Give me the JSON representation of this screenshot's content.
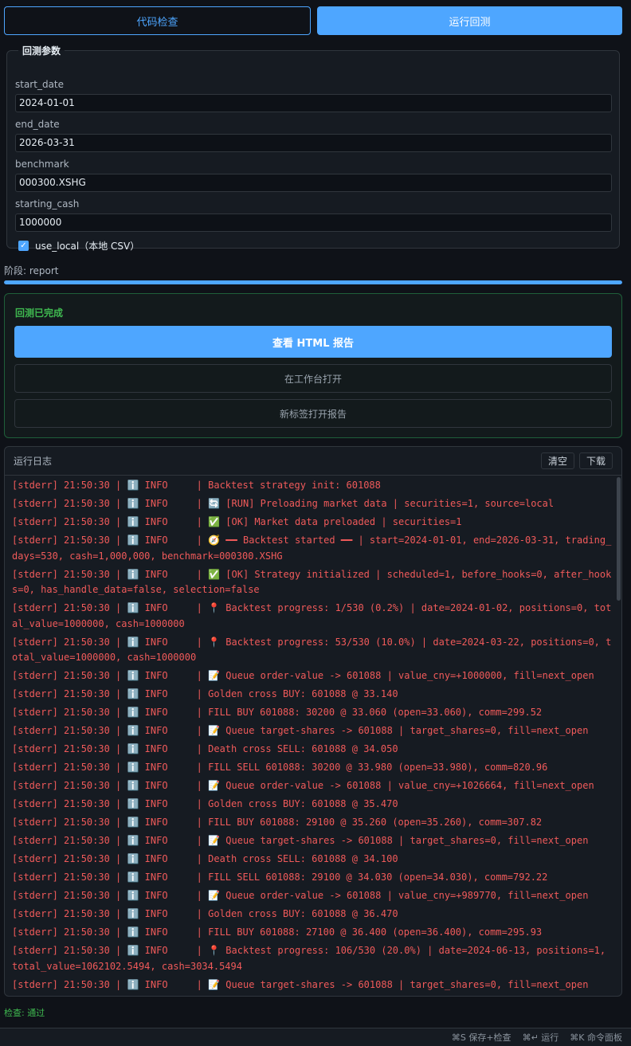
{
  "toolbar": {
    "check_label": "代码检查",
    "run_label": "运行回测"
  },
  "params": {
    "legend": "回测参数",
    "fields": [
      {
        "label": "start_date",
        "value": "2024-01-01"
      },
      {
        "label": "end_date",
        "value": "2026-03-31"
      },
      {
        "label": "benchmark",
        "value": "000300.XSHG"
      },
      {
        "label": "starting_cash",
        "value": "1000000"
      }
    ],
    "use_local_label": "use_local（本地 CSV）",
    "use_local_checked": true
  },
  "stage": {
    "text": "阶段: report",
    "progress": 1.0
  },
  "result": {
    "title": "回测已完成",
    "view_report_label": "查看 HTML 报告",
    "open_workbench_label": "在工作台打开",
    "open_new_tab_label": "新标签打开报告"
  },
  "log": {
    "title": "运行日志",
    "clear_label": "清空",
    "download_label": "下载",
    "lines": [
      "[stderr] 21:50:30 | ℹ️ INFO     | Backtest strategy init: 601088",
      "[stderr] 21:50:30 | ℹ️ INFO     | 🔄 [RUN] Preloading market data | securities=1, source=local",
      "[stderr] 21:50:30 | ℹ️ INFO     | ✅ [OK] Market data preloaded | securities=1",
      "[stderr] 21:50:30 | ℹ️ INFO     | 🧭 ━━ Backtest started ━━ | start=2024-01-01, end=2026-03-31, trading_days=530, cash=1,000,000, benchmark=000300.XSHG",
      "[stderr] 21:50:30 | ℹ️ INFO     | ✅ [OK] Strategy initialized | scheduled=1, before_hooks=0, after_hooks=0, has_handle_data=false, selection=false",
      "[stderr] 21:50:30 | ℹ️ INFO     | 📍 Backtest progress: 1/530 (0.2%) | date=2024-01-02, positions=0, total_value=1000000, cash=1000000",
      "[stderr] 21:50:30 | ℹ️ INFO     | 📍 Backtest progress: 53/530 (10.0%) | date=2024-03-22, positions=0, total_value=1000000, cash=1000000",
      "[stderr] 21:50:30 | ℹ️ INFO     | 📝 Queue order-value -> 601088 | value_cny=+1000000, fill=next_open",
      "[stderr] 21:50:30 | ℹ️ INFO     | Golden cross BUY: 601088 @ 33.140",
      "[stderr] 21:50:30 | ℹ️ INFO     | FILL BUY 601088: 30200 @ 33.060 (open=33.060), comm=299.52",
      "[stderr] 21:50:30 | ℹ️ INFO     | 📝 Queue target-shares -> 601088 | target_shares=0, fill=next_open",
      "[stderr] 21:50:30 | ℹ️ INFO     | Death cross SELL: 601088 @ 34.050",
      "[stderr] 21:50:30 | ℹ️ INFO     | FILL SELL 601088: 30200 @ 33.980 (open=33.980), comm=820.96",
      "[stderr] 21:50:30 | ℹ️ INFO     | 📝 Queue order-value -> 601088 | value_cny=+1026664, fill=next_open",
      "[stderr] 21:50:30 | ℹ️ INFO     | Golden cross BUY: 601088 @ 35.470",
      "[stderr] 21:50:30 | ℹ️ INFO     | FILL BUY 601088: 29100 @ 35.260 (open=35.260), comm=307.82",
      "[stderr] 21:50:30 | ℹ️ INFO     | 📝 Queue target-shares -> 601088 | target_shares=0, fill=next_open",
      "[stderr] 21:50:30 | ℹ️ INFO     | Death cross SELL: 601088 @ 34.100",
      "[stderr] 21:50:30 | ℹ️ INFO     | FILL SELL 601088: 29100 @ 34.030 (open=34.030), comm=792.22",
      "[stderr] 21:50:30 | ℹ️ INFO     | 📝 Queue order-value -> 601088 | value_cny=+989770, fill=next_open",
      "[stderr] 21:50:30 | ℹ️ INFO     | Golden cross BUY: 601088 @ 36.470",
      "[stderr] 21:50:30 | ℹ️ INFO     | FILL BUY 601088: 27100 @ 36.400 (open=36.400), comm=295.93",
      "[stderr] 21:50:30 | ℹ️ INFO     | 📍 Backtest progress: 106/530 (20.0%) | date=2024-06-13, positions=1, total_value=1062102.5494, cash=3034.5494",
      "[stderr] 21:50:30 | ℹ️ INFO     | 📝 Queue target-shares -> 601088 | target_shares=0, fill=next_open"
    ]
  },
  "status": {
    "check_result": "检查: 通过"
  },
  "footer": {
    "save_check": "⌘S 保存+检查",
    "run": "⌘↵ 运行",
    "palette": "⌘K 命令面板"
  },
  "colors": {
    "accent": "#4ea6ff",
    "success": "#3fb950",
    "log_text": "#f05a5a",
    "background": "#0f1218",
    "panel": "#161b22"
  }
}
